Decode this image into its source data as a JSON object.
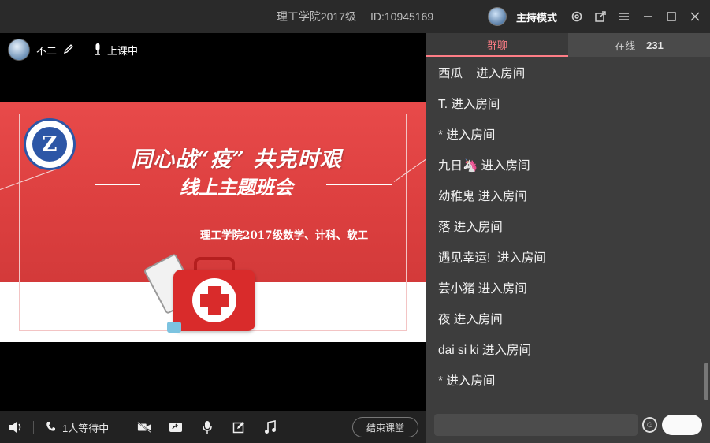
{
  "titlebar": {
    "room_name": "理工学院2017级",
    "room_id": "ID:10945169",
    "host_mode": "主持模式",
    "icons": [
      "settings-icon",
      "popout-icon",
      "menu-icon",
      "minimize-icon",
      "maximize-icon",
      "close-icon"
    ]
  },
  "stage": {
    "username": "不二",
    "status": "上课中",
    "slide": {
      "logo_letter": "Z",
      "title": "同心战“疫” 共克时艰",
      "subtitle": "线上主题班会",
      "credit": "理工学院2017级数学、计科、软工"
    }
  },
  "bottombar": {
    "waiting": "1人等待中",
    "end_label": "结束课堂"
  },
  "panel": {
    "tabs": [
      {
        "label": "群聊"
      },
      {
        "label": "在线",
        "count": "231"
      }
    ],
    "messages": [
      "西瓜    进入房间",
      "T. 进入房间",
      "* 进入房间",
      "九日🦄 进入房间",
      "幼稚鬼 进入房间",
      "落 进入房间",
      "遇见幸运!  进入房间",
      "芸小猪 进入房间",
      "夜 进入房间",
      "dai si ki 进入房间",
      "* 进入房间"
    ]
  },
  "colors": {
    "accent": "#ff7d86",
    "slide_red": "#e84a4a"
  }
}
